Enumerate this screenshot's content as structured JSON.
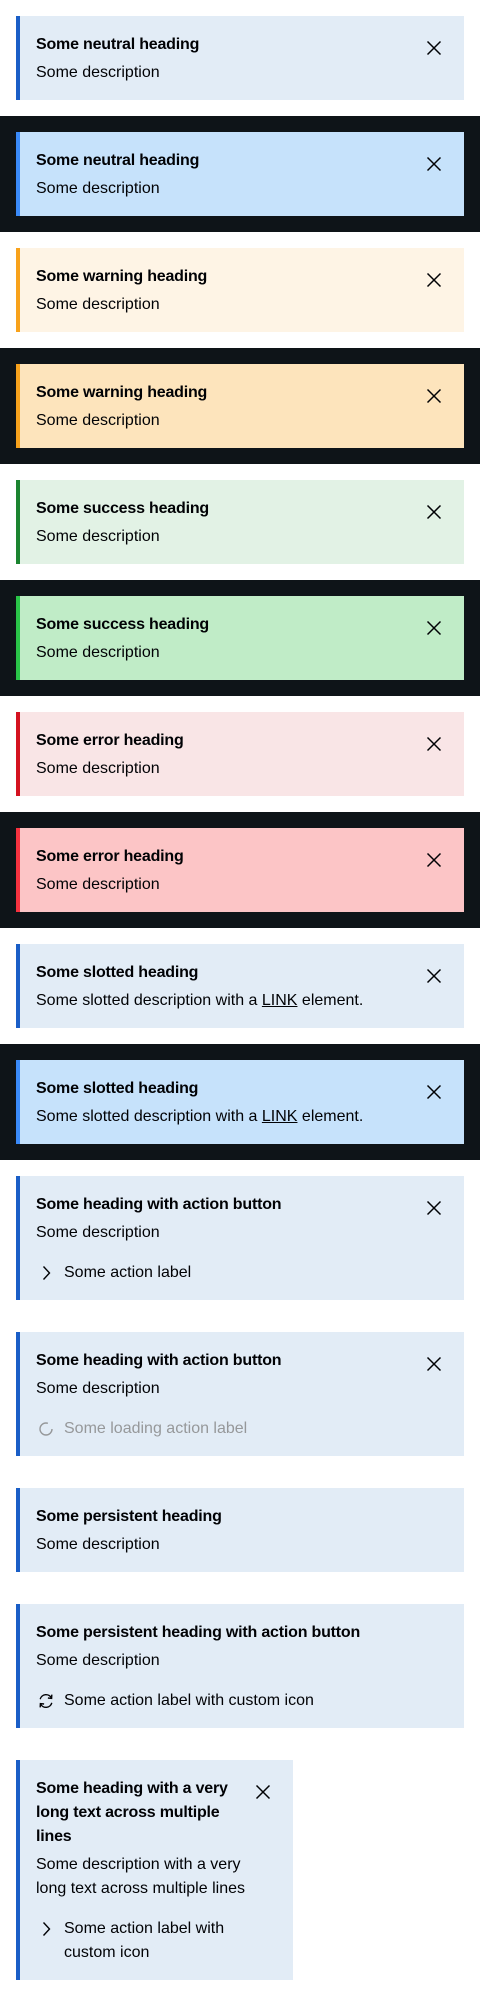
{
  "common": {
    "description": "Some description",
    "close_label": "Close"
  },
  "neutral": {
    "heading": "Some neutral heading"
  },
  "warning": {
    "heading": "Some warning heading"
  },
  "success": {
    "heading": "Some success heading"
  },
  "error": {
    "heading": "Some error heading"
  },
  "slotted": {
    "heading": "Some slotted heading",
    "desc_before": "Some slotted description with a ",
    "link": "LINK",
    "desc_after": " element."
  },
  "action_button": {
    "heading": "Some heading with action button",
    "action_label": "Some action label",
    "action_icon": "chevron-right-icon"
  },
  "loading_action": {
    "heading": "Some heading with action button",
    "action_label": "Some loading action label",
    "action_icon": "spinner-icon"
  },
  "persistent": {
    "heading": "Some persistent heading"
  },
  "persistent_action": {
    "heading": "Some persistent heading with action button",
    "action_label": "Some action label with custom icon",
    "action_icon": "reset-icon"
  },
  "long_text": {
    "heading": "Some heading with a very long text across multiple lines",
    "description": "Some description with a very long text across multiple lines",
    "action_label": "Some action label with custom icon",
    "action_icon": "chevron-right-icon"
  },
  "colors": {
    "neutral_light_bg": "#e2ecf6",
    "neutral_light_bar": "#1a5ec7",
    "neutral_dark_bg": "#c6e2fb",
    "neutral_dark_bar": "#3a8af8",
    "warning_light_bg": "#fef4e5",
    "warning_light_bar": "#f8a21b",
    "warning_dark_bg": "#fde4bc",
    "warning_dark_bar": "#f7a21c",
    "success_light_bg": "#e2f2e5",
    "success_light_bar": "#1b8430",
    "success_dark_bg": "#c0ecc7",
    "success_dark_bar": "#2ac548",
    "error_light_bg": "#f9e5e6",
    "error_light_bar": "#d41220",
    "error_dark_bg": "#fcc5c6",
    "error_dark_bar": "#f5323f",
    "dark_canvas": "#0e1418"
  }
}
